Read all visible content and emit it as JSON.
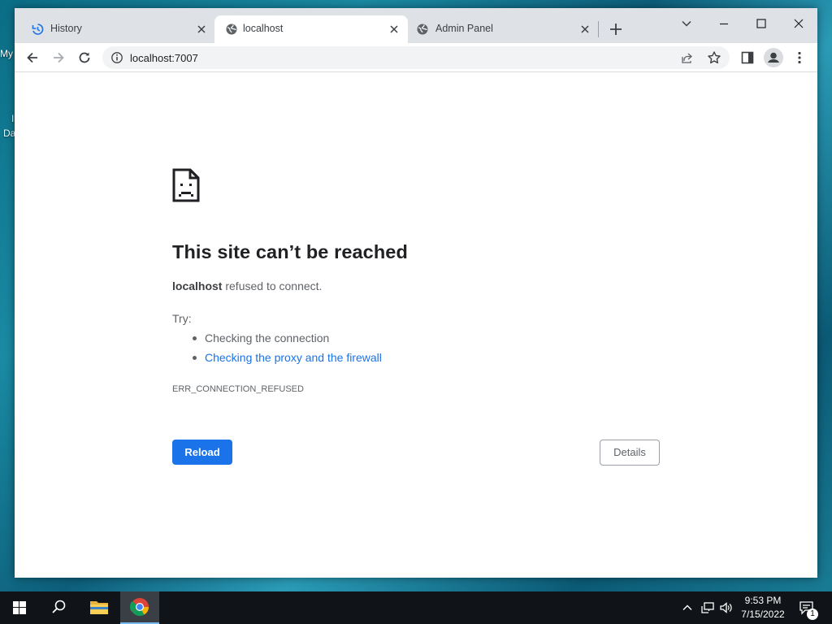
{
  "desktop": {
    "fragments": [
      "My",
      "I",
      "Da"
    ]
  },
  "browser": {
    "tabs": [
      {
        "label": "History",
        "icon": "history-icon",
        "active": false
      },
      {
        "label": "localhost",
        "icon": "globe-icon",
        "active": true
      },
      {
        "label": "Admin Panel",
        "icon": "globe-icon",
        "active": false
      }
    ],
    "url": "localhost:7007"
  },
  "error_page": {
    "title": "This site can’t be reached",
    "host": "localhost",
    "message": " refused to connect.",
    "try_label": "Try:",
    "suggestions": [
      {
        "text": "Checking the connection",
        "is_link": false
      },
      {
        "text": "Checking the proxy and the firewall",
        "is_link": true
      }
    ],
    "error_code": "ERR_CONNECTION_REFUSED",
    "reload_label": "Reload",
    "details_label": "Details"
  },
  "taskbar": {
    "time": "9:53 PM",
    "date": "7/15/2022",
    "notification_count": "1"
  },
  "colors": {
    "accent": "#1a73e8",
    "tabbar_bg": "#dee1e6",
    "taskbar_bg": "#101418"
  }
}
